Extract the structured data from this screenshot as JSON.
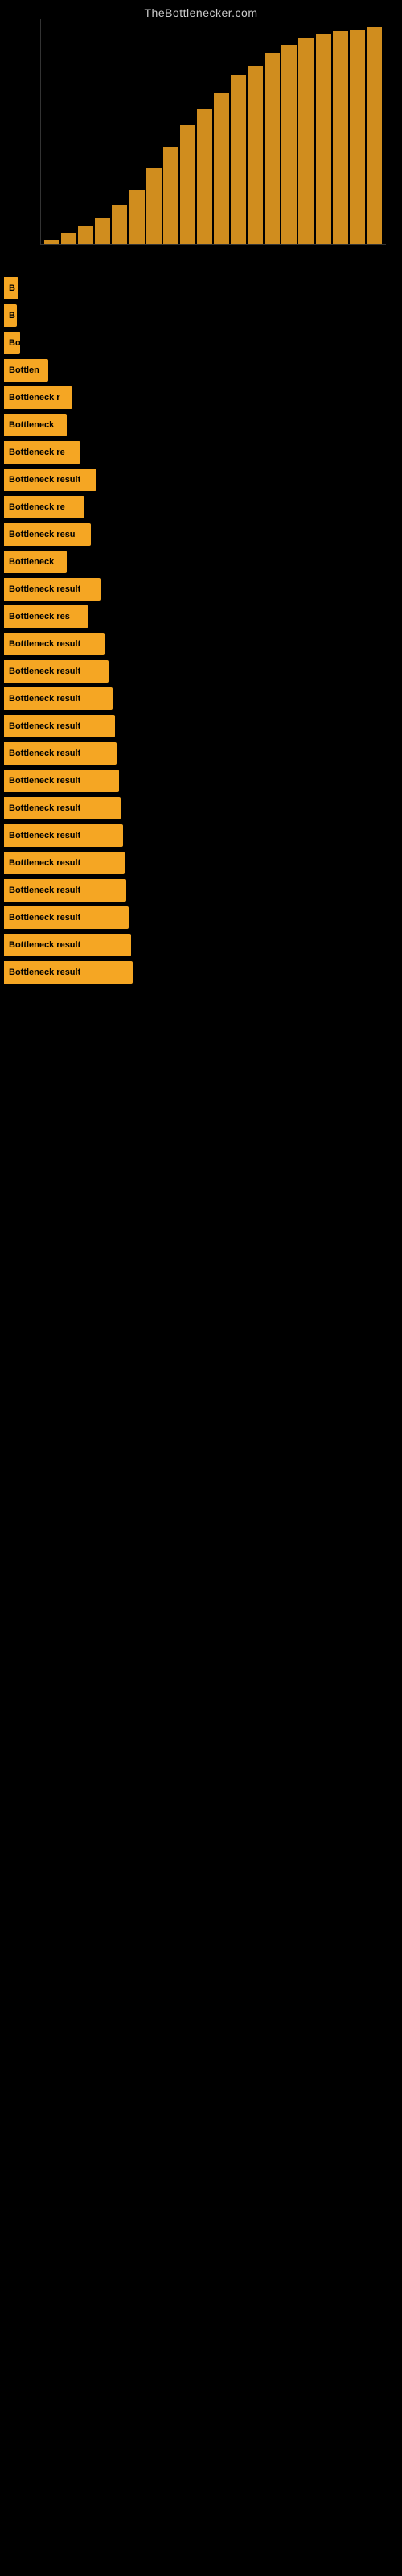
{
  "site": {
    "title": "TheBottlenecker.com"
  },
  "chart": {
    "bars": [
      2,
      5,
      8,
      12,
      18,
      25,
      35,
      45,
      55,
      62,
      70,
      78,
      82,
      88,
      92,
      95,
      97,
      98,
      99,
      100
    ]
  },
  "bottleneck_items": [
    {
      "id": 1,
      "label": "B",
      "width": 18
    },
    {
      "id": 2,
      "label": "B",
      "width": 16
    },
    {
      "id": 3,
      "label": "Bo",
      "width": 20
    },
    {
      "id": 4,
      "label": "Bottlen",
      "width": 55
    },
    {
      "id": 5,
      "label": "Bottleneck r",
      "width": 85
    },
    {
      "id": 6,
      "label": "Bottleneck",
      "width": 78
    },
    {
      "id": 7,
      "label": "Bottleneck re",
      "width": 95
    },
    {
      "id": 8,
      "label": "Bottleneck result",
      "width": 115
    },
    {
      "id": 9,
      "label": "Bottleneck re",
      "width": 100
    },
    {
      "id": 10,
      "label": "Bottleneck resu",
      "width": 108
    },
    {
      "id": 11,
      "label": "Bottleneck",
      "width": 78
    },
    {
      "id": 12,
      "label": "Bottleneck result",
      "width": 120
    },
    {
      "id": 13,
      "label": "Bottleneck res",
      "width": 105
    },
    {
      "id": 14,
      "label": "Bottleneck result",
      "width": 125
    },
    {
      "id": 15,
      "label": "Bottleneck result",
      "width": 130
    },
    {
      "id": 16,
      "label": "Bottleneck result",
      "width": 135
    },
    {
      "id": 17,
      "label": "Bottleneck result",
      "width": 138
    },
    {
      "id": 18,
      "label": "Bottleneck result",
      "width": 140
    },
    {
      "id": 19,
      "label": "Bottleneck result",
      "width": 143
    },
    {
      "id": 20,
      "label": "Bottleneck result",
      "width": 145
    },
    {
      "id": 21,
      "label": "Bottleneck result",
      "width": 148
    },
    {
      "id": 22,
      "label": "Bottleneck result",
      "width": 150
    },
    {
      "id": 23,
      "label": "Bottleneck result",
      "width": 152
    },
    {
      "id": 24,
      "label": "Bottleneck result",
      "width": 155
    },
    {
      "id": 25,
      "label": "Bottleneck result",
      "width": 158
    },
    {
      "id": 26,
      "label": "Bottleneck result",
      "width": 160
    }
  ]
}
